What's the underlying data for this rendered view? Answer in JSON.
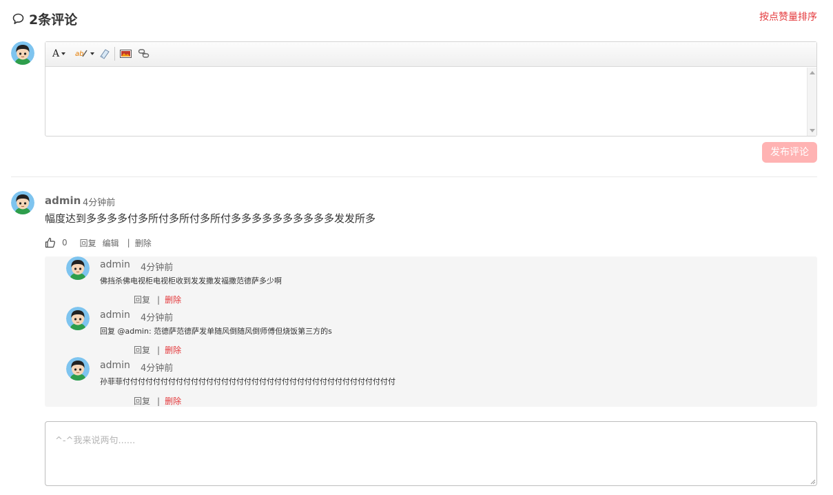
{
  "header": {
    "title": "2条评论",
    "sort_label": "按点赞量排序"
  },
  "editor": {
    "toolbar": [
      "font-color-icon",
      "highlight-color-icon",
      "eraser-icon",
      "image-icon",
      "link-icon"
    ],
    "publish_label": "发布评论"
  },
  "comment": {
    "user": "admin",
    "time": "4分钟前",
    "content": "幅度达到多多多多付多所付多所付多所付多多多多多多多多多多发发所多",
    "likes": "0",
    "reply_label": "回复",
    "edit_label": "编辑",
    "separator": "|",
    "delete_label": "删除"
  },
  "replies": [
    {
      "user": "admin",
      "time": "4分钟前",
      "content": "佛挡杀佛电视柜电视柜收到发发撒发福撒范德萨多少啊",
      "reply_label": "回复",
      "separator": "|",
      "delete_label": "删除"
    },
    {
      "user": "admin",
      "time": "4分钟前",
      "content": "回复 @admin: 范德萨范德萨发单随风倒随风倒师傅但烧饭第三方的s",
      "reply_label": "回复",
      "separator": "|",
      "delete_label": "删除"
    },
    {
      "user": "admin",
      "time": "4分钟前",
      "content": "孙菲菲付付付付付付付付付付付付付付付付付付付付付付付付付付付付付付付付付付付付",
      "reply_label": "回复",
      "separator": "|",
      "delete_label": "删除"
    }
  ],
  "reply_box": {
    "placeholder": "^-^我来说两句......"
  },
  "colors": {
    "accent_red": "#e4393c",
    "publish_disabled": "#ffb3b3",
    "reply_bg": "#f5f5f5"
  }
}
